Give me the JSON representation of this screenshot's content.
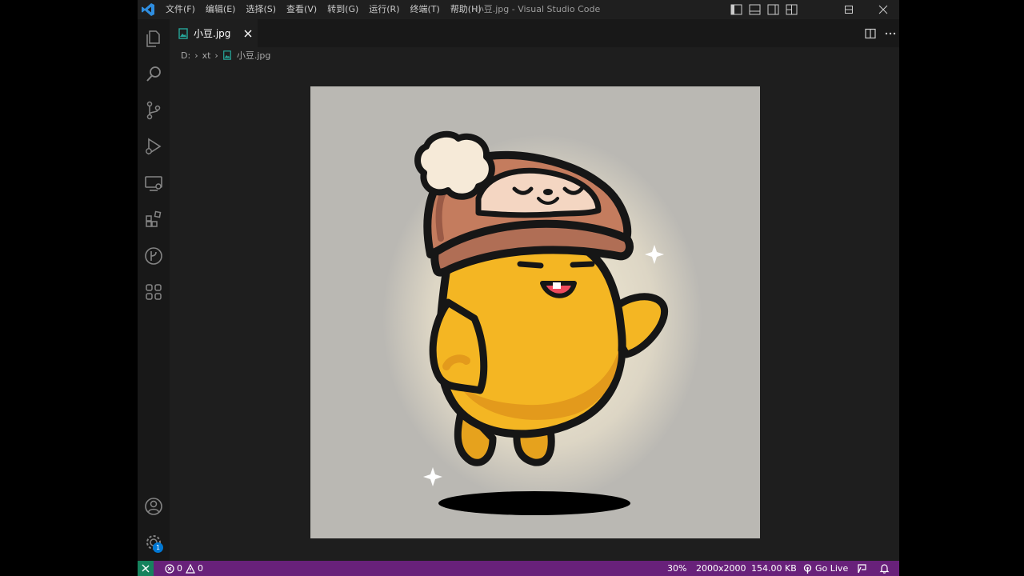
{
  "window": {
    "title": "小豆.jpg - Visual Studio Code"
  },
  "menu": [
    "文件(F)",
    "编辑(E)",
    "选择(S)",
    "查看(V)",
    "转到(G)",
    "运行(R)",
    "终端(T)",
    "帮助(H)"
  ],
  "tab": {
    "label": "小豆.jpg"
  },
  "breadcrumb": {
    "drive": "D:",
    "folder": "xt",
    "file": "小豆.jpg"
  },
  "activity": {
    "settings_badge": "1"
  },
  "status": {
    "errors": "0",
    "warnings": "0",
    "zoom": "30%",
    "dimensions": "2000x2000",
    "filesize": "154.00 KB",
    "golive": "Go Live"
  },
  "colors": {
    "statusbar": "#68217a",
    "remote": "#16825d",
    "image_background": "#bab8b3",
    "character_body": "#f4b623",
    "hat": "#b06e55"
  },
  "image": {
    "subject": "yellow bean character wearing a sloth beanie, waving"
  }
}
